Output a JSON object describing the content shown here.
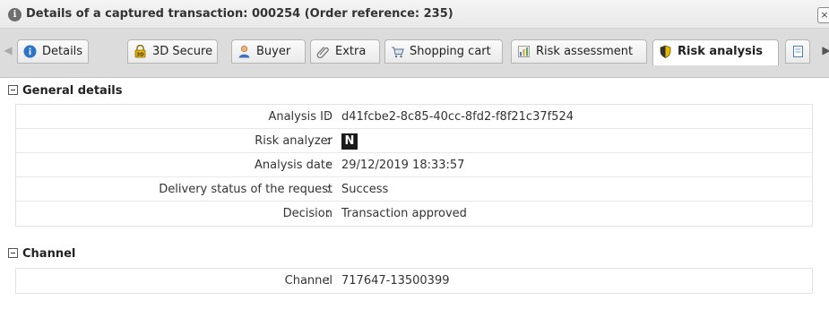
{
  "window": {
    "title": "Details of a captured transaction: 000254 (Order reference: 235)",
    "close_glyph": "×"
  },
  "tabs": [
    {
      "label": "Details",
      "icon": "info-icon"
    },
    {
      "label": "3D Secure",
      "icon": "lock-3d-icon"
    },
    {
      "label": "Buyer",
      "icon": "person-icon"
    },
    {
      "label": "Extra",
      "icon": "paperclip-icon"
    },
    {
      "label": "Shopping cart",
      "icon": "cart-icon"
    },
    {
      "label": "Risk assessment",
      "icon": "chart-icon"
    },
    {
      "label": "Risk analysis",
      "icon": "shield-icon",
      "active": true
    },
    {
      "label": "",
      "icon": "document-icon"
    }
  ],
  "sections": {
    "general": {
      "title": "General details",
      "rows": [
        {
          "key": "Analysis ID",
          "value": "d41fcbe2-8c85-40cc-8fd2-f8f21c37f524"
        },
        {
          "key": "Risk analyzer",
          "value": "N"
        },
        {
          "key": "Analysis date",
          "value": "29/12/2019 18:33:57"
        },
        {
          "key": "Delivery status of the request",
          "value": "Success"
        },
        {
          "key": "Decision",
          "value": "Transaction approved"
        }
      ]
    },
    "channel": {
      "title": "Channel",
      "rows": [
        {
          "key": "Channel",
          "value": "717647-13500399"
        }
      ]
    }
  },
  "separator": ":",
  "colors": {
    "value_text": "#333333",
    "titlebar_bg": "#eeeeee",
    "tabstrip_bg": "#dcdcdc"
  }
}
